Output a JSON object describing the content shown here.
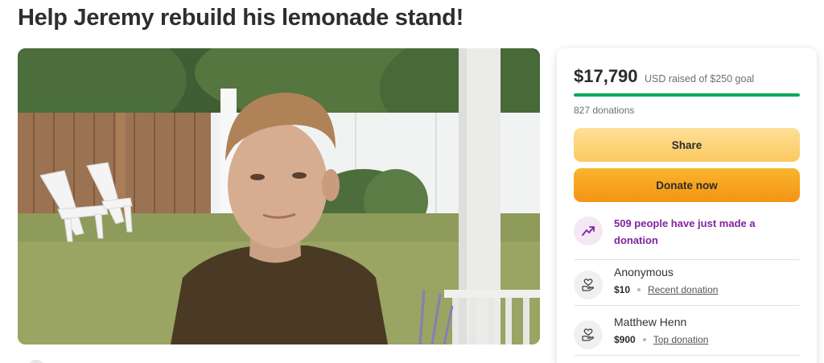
{
  "page": {
    "title": "Help Jeremy rebuild his lemonade stand!"
  },
  "photo": {
    "alt": ""
  },
  "donation_card": {
    "amount_raised": "$17,790",
    "goal_text": "USD raised of $250 goal",
    "progress_percent": 100,
    "donation_count": "827 donations",
    "share_label": "Share",
    "donate_label": "Donate now",
    "trend_text": "509 people have just made a donation",
    "donors": [
      {
        "name": "Anonymous",
        "amount": "$10",
        "tag": "Recent donation"
      },
      {
        "name": "Matthew Henn",
        "amount": "$900",
        "tag": "Top donation"
      }
    ]
  },
  "colors": {
    "progress": "#02a95c",
    "donate": "#f49414",
    "share": "#fcc860",
    "trend_text": "#7f24a0"
  },
  "icons": {
    "trend": "trending-up-icon",
    "donor": "heart-hand-icon"
  }
}
